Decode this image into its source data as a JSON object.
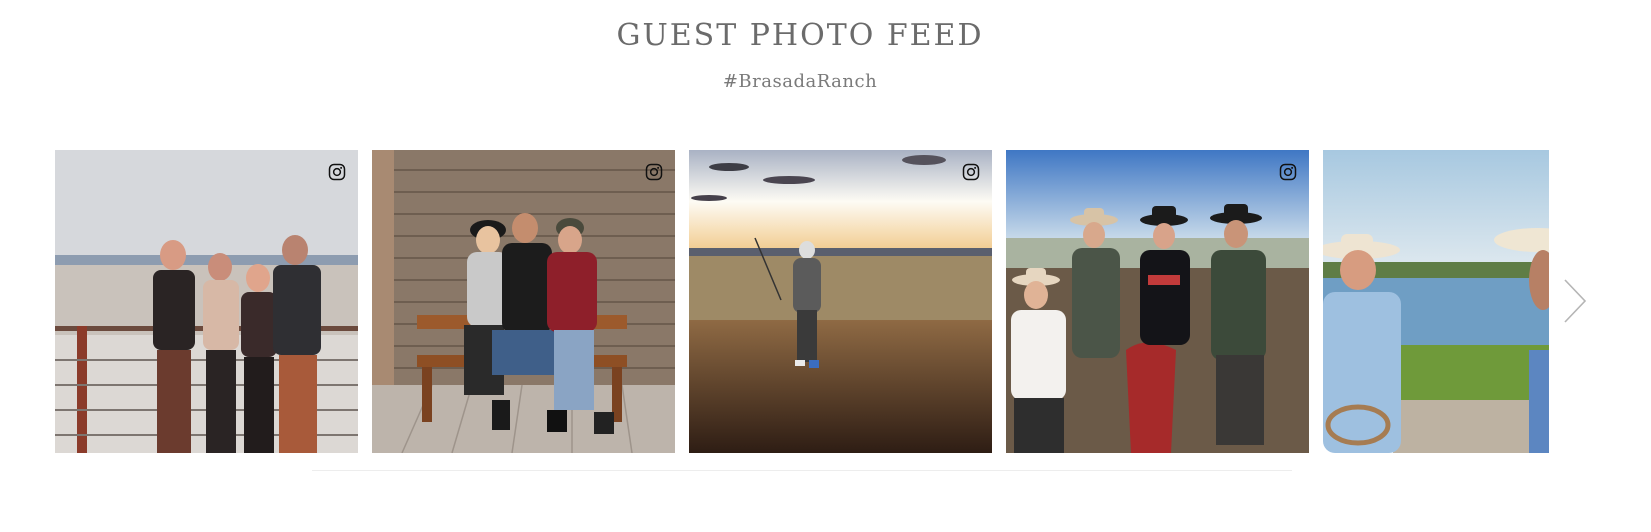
{
  "feed": {
    "title": "GUEST PHOTO FEED",
    "hashtag": "#BrasadaRanch"
  },
  "photos": [
    {
      "name": "friends-on-deck-photo",
      "icon": "instagram-icon"
    },
    {
      "name": "women-on-bench-photo",
      "icon": "instagram-icon"
    },
    {
      "name": "golfer-at-sunset-photo",
      "icon": "instagram-icon"
    },
    {
      "name": "cowboys-group-photo",
      "icon": "instagram-icon"
    },
    {
      "name": "cowboy-by-pond-photo",
      "icon": "instagram-icon"
    }
  ],
  "navigation": {
    "next_icon": "chevron-right-icon"
  },
  "colors": {
    "title": "#6b6b6b",
    "hashtag": "#7a7a7a",
    "divider": "#ededed"
  }
}
